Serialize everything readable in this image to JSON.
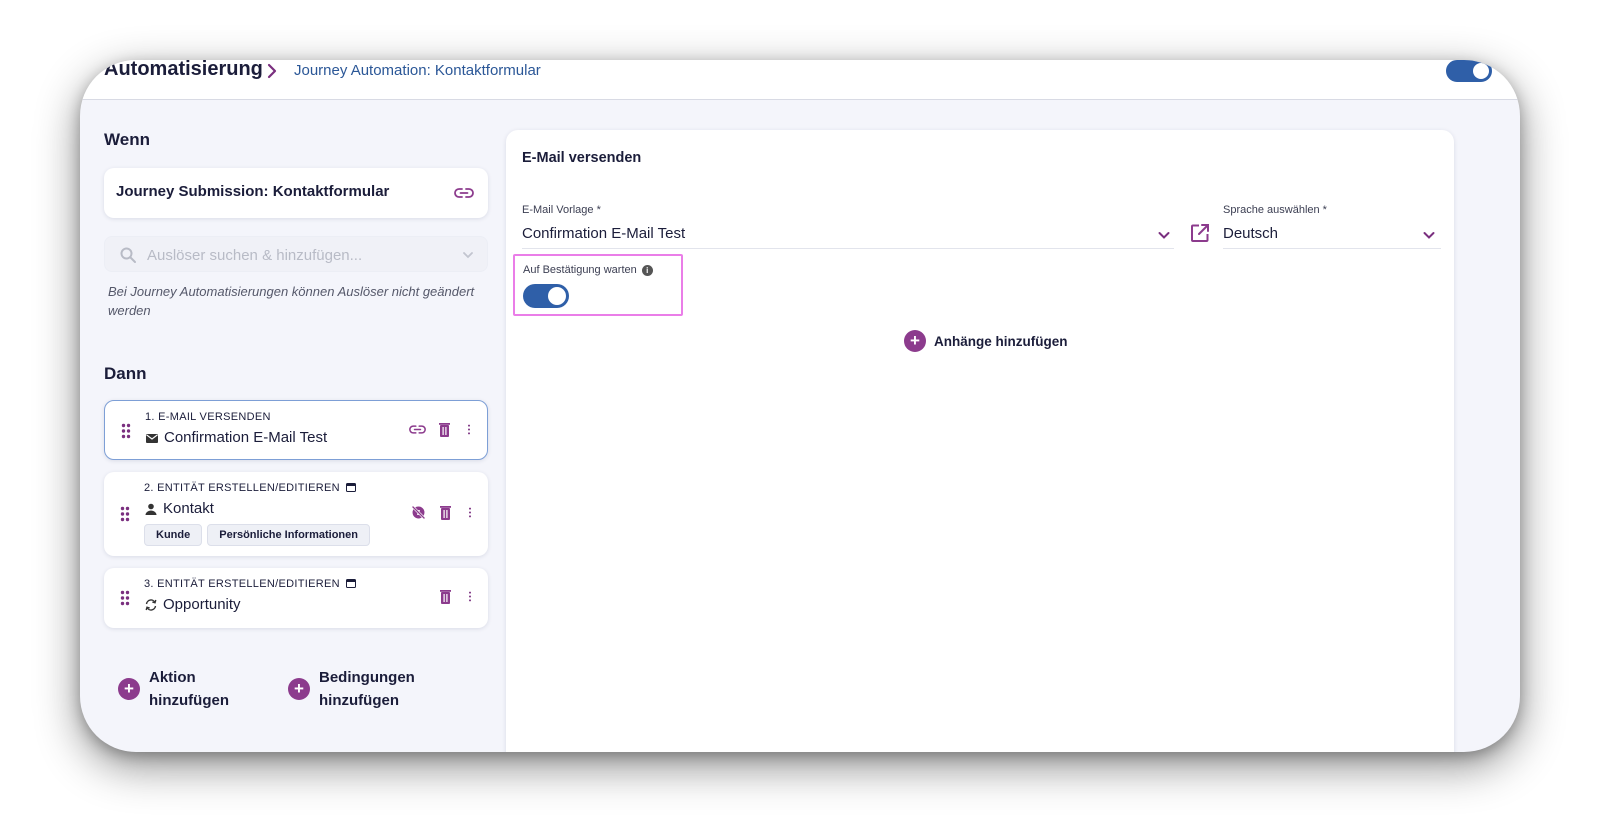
{
  "header": {
    "breadcrumb_root": "Automatisierung",
    "breadcrumb_current": "Journey Automation: Kontaktformular",
    "active_toggle": "on"
  },
  "when": {
    "title": "Wenn",
    "trigger_label": "Journey Submission: Kontaktformular",
    "search_placeholder": "Auslöser suchen & hinzufügen...",
    "hint": "Bei Journey Automatisierungen können Auslöser nicht geändert werden"
  },
  "then": {
    "title": "Dann",
    "actions": [
      {
        "title": "1. E-MAIL VERSENDEN",
        "name": "Confirmation E-Mail Test",
        "icon": "mail-icon"
      },
      {
        "title": "2. ENTITÄT ERSTELLEN/EDITIEREN",
        "name": "Kontakt",
        "icon": "person-icon",
        "tags": [
          "Kunde",
          "Persönliche Informationen"
        ]
      },
      {
        "title": "3. ENTITÄT ERSTELLEN/EDITIEREN",
        "name": "Opportunity",
        "icon": "sync-icon"
      }
    ],
    "add_action": [
      "Aktion",
      "hinzufügen"
    ],
    "add_condition": [
      "Bedingungen",
      "hinzufügen"
    ]
  },
  "panel": {
    "title": "E-Mail versenden",
    "template_label": "E-Mail Vorlage *",
    "template_value": "Confirmation E-Mail Test",
    "language_label": "Sprache auswählen *",
    "language_value": "Deutsch",
    "confirm_label": "Auf Bestätigung warten",
    "confirm_toggle": "on",
    "attachments_label": "Anhänge hinzufügen"
  },
  "colors": {
    "accent_purple": "#8c3b8d",
    "toggle_blue": "#2f5fa8",
    "highlight_pink": "#ea7ee8",
    "breadcrumb_blue": "#2b5797"
  }
}
